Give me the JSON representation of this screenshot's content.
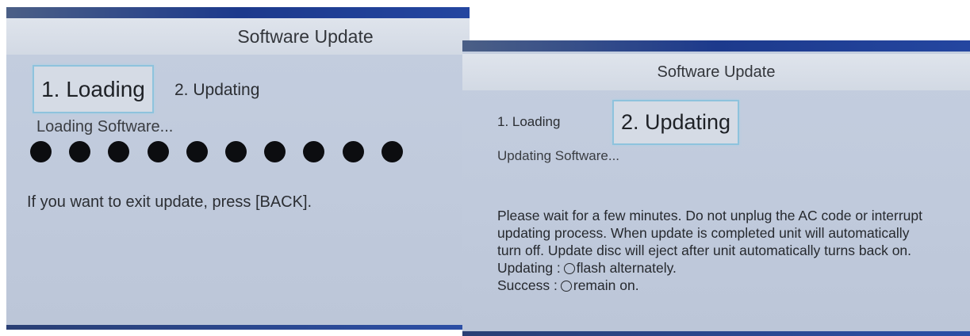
{
  "left_screen": {
    "title": "Software Update",
    "steps": [
      {
        "label": "1. Loading",
        "active": true
      },
      {
        "label": "2. Updating",
        "active": false
      }
    ],
    "status": "Loading Software...",
    "progress_dots": 10,
    "hint": "If you want to exit update, press [BACK]."
  },
  "right_screen": {
    "title": "Software Update",
    "steps": [
      {
        "label": "1. Loading",
        "active": false
      },
      {
        "label": "2. Updating",
        "active": true
      }
    ],
    "status": "Updating Software...",
    "message_lines": [
      "Please wait for a few minutes. Do not unplug the AC code or interrupt",
      "updating process. When update is completed unit will automatically",
      "turn off. Update disc will eject after unit automatically turns back on."
    ],
    "legend": [
      {
        "prefix": "Updating :",
        "icon": "circle-icon",
        "text": "flash alternately."
      },
      {
        "prefix": "Success :",
        "icon": "circle-icon",
        "text": "remain on."
      }
    ]
  },
  "colors": {
    "screen_bg": "#c0cadc",
    "title_bar": "#d6dce6",
    "active_step_border": "#8ec3dd",
    "dot": "#0c0d10"
  }
}
